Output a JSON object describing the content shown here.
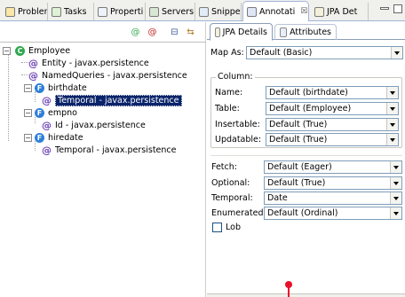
{
  "tabs": [
    {
      "label": "Problem",
      "icon": "problems-icon"
    },
    {
      "label": "Tasks",
      "icon": "tasks-icon"
    },
    {
      "label": "Properti",
      "icon": "properties-icon"
    },
    {
      "label": "Servers",
      "icon": "servers-icon"
    },
    {
      "label": "Snippet",
      "icon": "snippets-icon"
    },
    {
      "label": "Annotati",
      "icon": "annotations-icon",
      "active": true,
      "close": "☒"
    },
    {
      "label": "JPA Det",
      "icon": "jpa-details-icon"
    }
  ],
  "tree": {
    "root": "Employee",
    "items": [
      {
        "label": "Entity - javax.persistence"
      },
      {
        "label": "NamedQueries - javax.persistence"
      },
      {
        "label": "birthdate"
      },
      {
        "label": "Temporal - javax.persistence",
        "selected": true
      },
      {
        "label": "empno"
      },
      {
        "label": "Id - javax.persistence"
      },
      {
        "label": "hiredate"
      },
      {
        "label": "Temporal - javax.persistence"
      }
    ]
  },
  "details": {
    "tab_jpa": "JPA Details",
    "tab_attributes": "Attributes",
    "map_as_label": "Map As:",
    "map_as_value": "Default (Basic)",
    "column_group": "Column:",
    "name_label": "Name:",
    "name_value": "Default (birthdate)",
    "table_label": "Table:",
    "table_value": "Default (Employee)",
    "insertable_label": "Insertable:",
    "insertable_value": "Default (True)",
    "updatable_label": "Updatable:",
    "updatable_value": "Default (True)",
    "fetch_label": "Fetch:",
    "fetch_value": "Default (Eager)",
    "optional_label": "Optional:",
    "optional_value": "Default (True)",
    "temporal_label": "Temporal:",
    "temporal_value": "Date",
    "enumerated_label": "Enumerated:",
    "enumerated_value": "Default (Ordinal)",
    "lob_label": "Lob"
  },
  "colors": {
    "selection": "#0a246a",
    "entity_icon": "#2fa84f",
    "attribute_icon": "#2f7fd8",
    "annotation_icon": "#6a3fb5",
    "marker": "#e8102a"
  }
}
